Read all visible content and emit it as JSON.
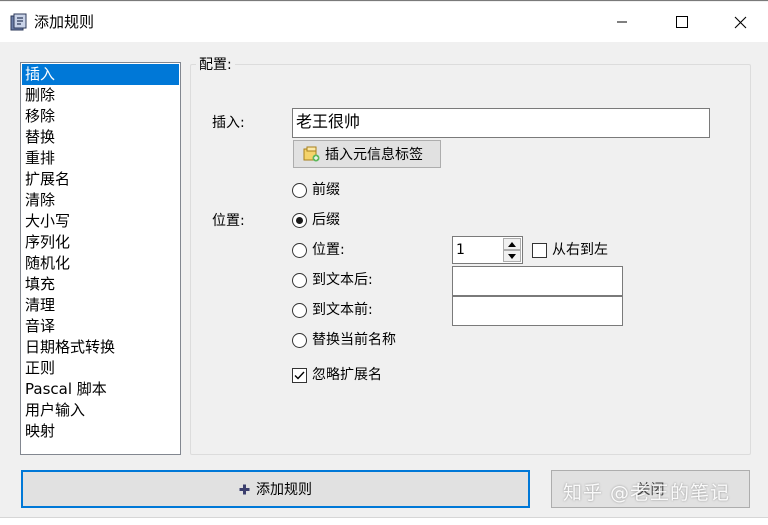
{
  "window": {
    "title": "添加规则",
    "controls": {
      "minimize_icon": "minimize-icon",
      "maximize_icon": "maximize-icon",
      "close_icon": "close-icon"
    }
  },
  "rules_list": {
    "selected_index": 0,
    "items": [
      "插入",
      "删除",
      "移除",
      "替换",
      "重排",
      "扩展名",
      "清除",
      "大小写",
      "序列化",
      "随机化",
      "填充",
      "清理",
      "音译",
      "日期格式转换",
      "正则",
      "Pascal 脚本",
      "用户输入",
      "映射"
    ]
  },
  "config": {
    "group_title": "配置:",
    "insert_label": "插入:",
    "insert_value": "老王很帅",
    "meta_button_label": "插入元信息标签",
    "position_label": "位置:",
    "options": {
      "prefix": {
        "label": "前缀",
        "checked": false
      },
      "suffix": {
        "label": "后缀",
        "checked": true
      },
      "position": {
        "label": "位置:",
        "checked": false
      },
      "after_text": {
        "label": "到文本后:",
        "checked": false
      },
      "before_text": {
        "label": "到文本前:",
        "checked": false
      },
      "replace_name": {
        "label": "替换当前名称",
        "checked": false
      }
    },
    "position_value": "1",
    "right_to_left": {
      "label": "从右到左",
      "checked": false
    },
    "after_text_value": "",
    "before_text_value": "",
    "ignore_extension": {
      "label": "忽略扩展名",
      "checked": true
    }
  },
  "buttons": {
    "add_rule": "添加规则",
    "close": "关闭"
  },
  "watermark": "知乎 @老王的笔记",
  "colors": {
    "selection": "#0078d7",
    "window_bg": "#f0f0f0",
    "button_bg": "#e1e1e1",
    "add_rule_icon": "#3c3f6e"
  }
}
